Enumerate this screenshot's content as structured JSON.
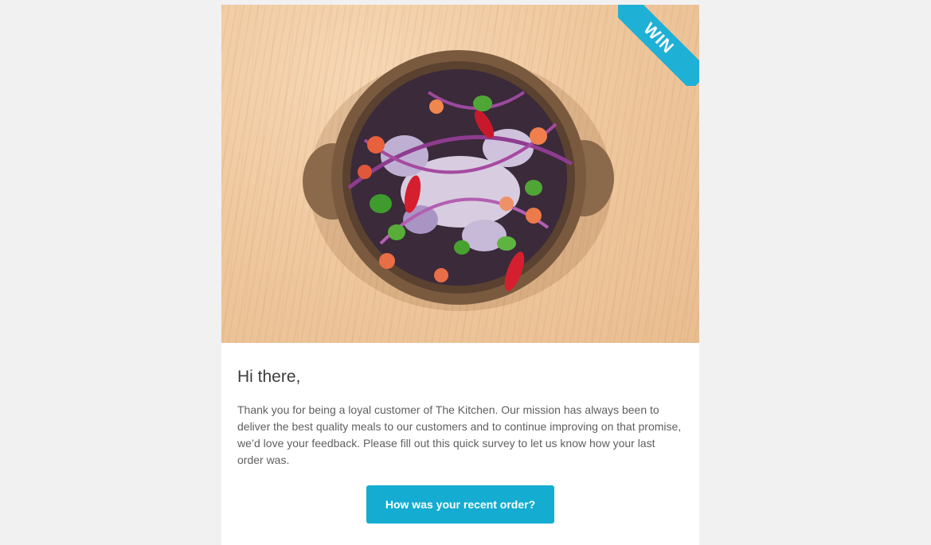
{
  "hero": {
    "ribbon_label": "WIN",
    "image_subject": "salad-bowl-image"
  },
  "email": {
    "greeting": "Hi there,",
    "body": "Thank you for being a loyal customer of The Kitchen. Our mission has always been to deliver the best quality meals to our customers and to continue improving on that promise, we’d love your feedback. Please fill out this quick survey to let us know how your last order was.",
    "cta_label": "How was your recent order?"
  },
  "colors": {
    "page_background": "#f1f1f1",
    "card_background": "#ffffff",
    "accent": "#14acd1",
    "ribbon": "#1fb0d6",
    "heading_text": "#3d3d3d",
    "body_text": "#5f5f5f"
  }
}
